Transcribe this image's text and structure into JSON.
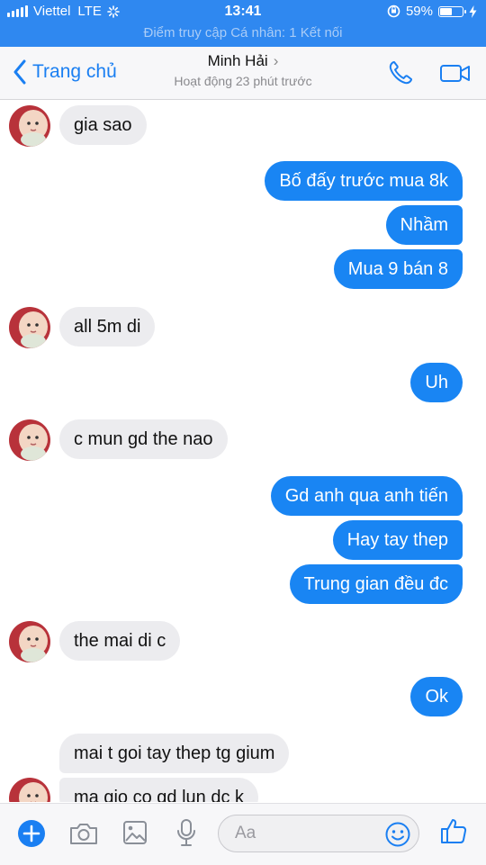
{
  "status": {
    "carrier": "Viettel",
    "network": "LTE",
    "time": "13:41",
    "battery": "59%",
    "battery_level": 0.59,
    "hotspot": "Điểm truy cập Cá nhân: 1 Kết nối"
  },
  "header": {
    "back_label": "Trang chủ",
    "name": "Minh Hải",
    "status": "Hoạt động 23 phút trước"
  },
  "messages": [
    {
      "from": "them",
      "text": "gia sao"
    },
    {
      "from": "me",
      "text": "Bố đấy trước mua 8k"
    },
    {
      "from": "me",
      "text": "Nhầm"
    },
    {
      "from": "me",
      "text": "Mua 9 bán 8"
    },
    {
      "from": "them",
      "text": "all 5m di"
    },
    {
      "from": "me",
      "text": "Uh"
    },
    {
      "from": "them",
      "text": "c mun gd the nao"
    },
    {
      "from": "me",
      "text": "Gd anh qua anh tiến"
    },
    {
      "from": "me",
      "text": "Hay tay thep"
    },
    {
      "from": "me",
      "text": "Trung gian đều đc"
    },
    {
      "from": "them",
      "text": "the mai di c"
    },
    {
      "from": "me",
      "text": "Ok"
    },
    {
      "from": "them",
      "text": "mai t goi tay thep tg gium"
    },
    {
      "from": "them",
      "text": "ma gio co gd lun dc k"
    }
  ],
  "composer": {
    "placeholder": "Aa"
  },
  "colors": {
    "accent": "#1985f3",
    "status_bar": "#2f88f0",
    "incoming_bubble": "#ececef"
  }
}
